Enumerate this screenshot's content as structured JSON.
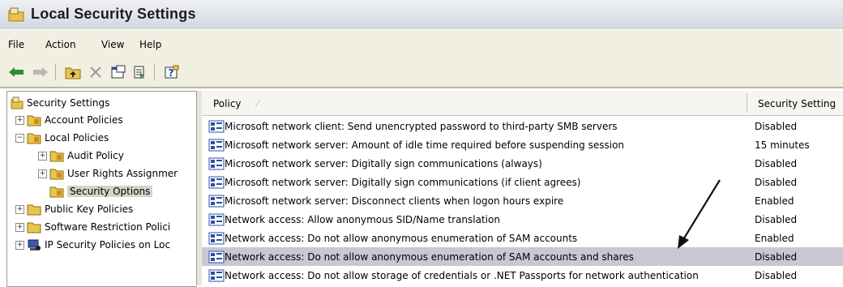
{
  "window": {
    "title": "Local Security Settings"
  },
  "menu": [
    "File",
    "Action",
    "View",
    "Help"
  ],
  "toolbar_icons": [
    "back-arrow-icon",
    "forward-arrow-icon",
    "up-folder-icon",
    "delete-icon",
    "properties-icon",
    "export-list-icon",
    "help-icon"
  ],
  "tree": {
    "root": "Security Settings",
    "account_policies": "Account Policies",
    "local_policies": "Local Policies",
    "audit_policy": "Audit Policy",
    "user_rights": "User Rights Assignmer",
    "security_options": "Security Options",
    "public_key": "Public Key Policies",
    "software_restriction": "Software Restriction Polici",
    "ip_security": "IP Security Policies on Loc"
  },
  "columns": {
    "policy": "Policy",
    "setting": "Security Setting"
  },
  "rows": [
    {
      "policy": "Microsoft network client: Send unencrypted password to third-party SMB servers",
      "setting": "Disabled"
    },
    {
      "policy": "Microsoft network server: Amount of idle time required before suspending session",
      "setting": "15 minutes"
    },
    {
      "policy": "Microsoft network server: Digitally sign communications (always)",
      "setting": "Disabled"
    },
    {
      "policy": "Microsoft network server: Digitally sign communications (if client agrees)",
      "setting": "Disabled"
    },
    {
      "policy": "Microsoft network server: Disconnect clients when logon hours expire",
      "setting": "Enabled"
    },
    {
      "policy": "Network access: Allow anonymous SID/Name translation",
      "setting": "Disabled"
    },
    {
      "policy": "Network access: Do not allow anonymous enumeration of SAM accounts",
      "setting": "Enabled"
    },
    {
      "policy": "Network access: Do not allow anonymous enumeration of SAM accounts and shares",
      "setting": "Disabled"
    },
    {
      "policy": "Network access: Do not allow storage of credentials or .NET Passports for network authentication",
      "setting": "Disabled"
    }
  ],
  "colors": {
    "highlight_row": "#c7c8d2",
    "toolbar_bg": "#f1efe2"
  }
}
